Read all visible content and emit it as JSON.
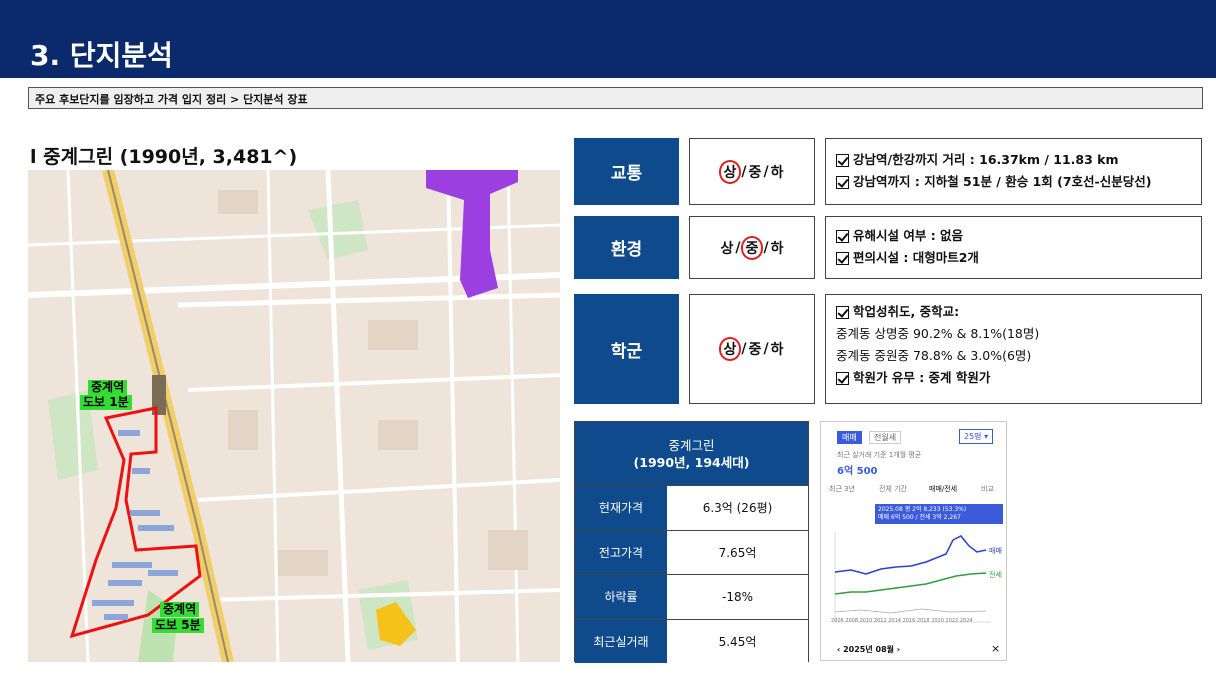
{
  "header": {
    "title": "3. 단지분석"
  },
  "breadcrumb": "주요 후보단지를 임장하고 가격 입지 정리 > 단지분석 장표",
  "complex": {
    "title": "l 중계그린 (1990년, 3,481^)"
  },
  "map": {
    "stations": [
      {
        "name": "중계역",
        "walk": "도보 1분"
      },
      {
        "name": "중계역",
        "walk": "도보 5분"
      }
    ]
  },
  "categories": [
    {
      "label": "교통",
      "grades": [
        "상",
        "중",
        "하"
      ],
      "selected": "상",
      "details": [
        {
          "text": "강남역/한강까지 거리 : 16.37km / 11.83 km",
          "checked": true
        },
        {
          "text": "강남역까지 : 지하철 51분 / 환승 1회 (7호선-신분당선)",
          "checked": true
        }
      ]
    },
    {
      "label": "환경",
      "grades": [
        "상",
        "중",
        "하"
      ],
      "selected": "중",
      "details": [
        {
          "text": "유해시설 여부 : 없음",
          "checked": true
        },
        {
          "text": "편의시설 : 대형마트2개",
          "checked": true
        }
      ]
    },
    {
      "label": "학군",
      "grades": [
        "상",
        "중",
        "하"
      ],
      "selected": "상",
      "details": [
        {
          "text": "학업성취도, 중학교:",
          "checked": true
        },
        {
          "text": "중계동 상명중 90.2% & 8.1%(18명)",
          "checked": false
        },
        {
          "text": "중계동 중원중 78.8% & 3.0%(6명)",
          "checked": false
        },
        {
          "text": "학원가 유무 : 중계 학원가",
          "checked": true
        }
      ]
    }
  ],
  "price_table": {
    "name": "중계그린",
    "sub": "(1990년, 194세대)",
    "rows": [
      {
        "label": "현재가격",
        "value": "6.3억 (26평)"
      },
      {
        "label": "전고가격",
        "value": "7.65억"
      },
      {
        "label": "하락률",
        "value": "-18%"
      },
      {
        "label": "최근실거래",
        "value": "5.45억"
      }
    ]
  },
  "chart_card": {
    "tabs": [
      "매매",
      "전월세"
    ],
    "area_select": "25평",
    "caption": "최근 실거래 기준 1개월 평균",
    "price": "6억 500",
    "period_tabs": [
      "최근 3년",
      "전체 기간",
      "매매/전세",
      "비교"
    ],
    "tooltip_line1": "2025.08  평 2억 8,233 (53.3%)",
    "tooltip_line2": "매매 6억 500 / 전세 3억 2,267",
    "legend_sale": "매매",
    "legend_rent": "전세",
    "footer_date": "2025년 08월",
    "footer_close": "×",
    "x_axis": "2006 2008 2010 2012 2014 2016 2018 2020 2022 2024"
  }
}
